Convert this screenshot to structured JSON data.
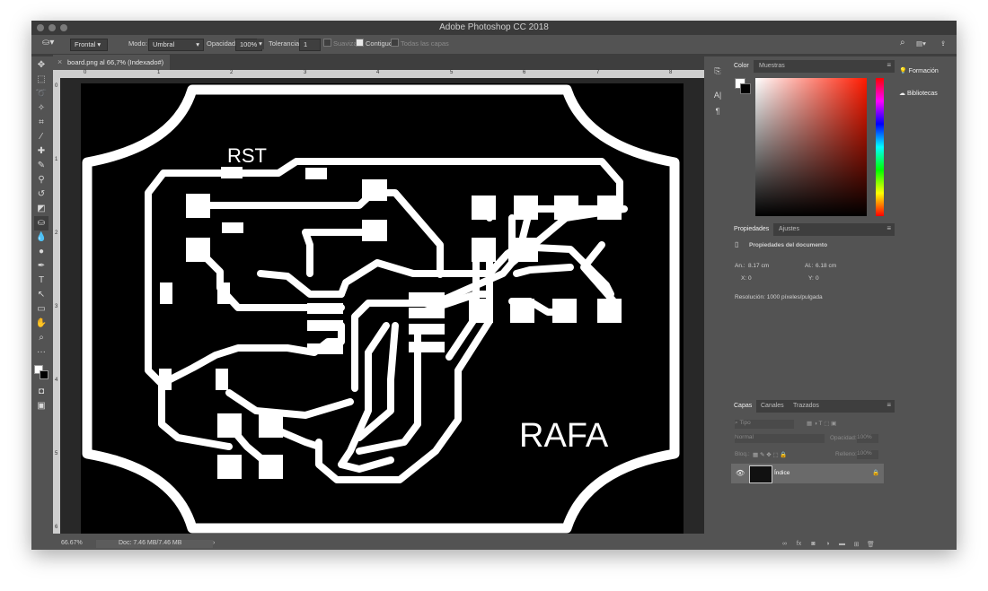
{
  "window": {
    "title": "Adobe Photoshop CC 2018"
  },
  "options_bar": {
    "preset": "Frontal",
    "mode_label": "Modo:",
    "mode_value": "Umbral",
    "opacity_label": "Opacidad:",
    "opacity_value": "100%",
    "tolerance_label": "Tolerancia:",
    "tolerance_value": "1",
    "smooth_label": "Suavizar",
    "contiguous_label": "Contiguo",
    "all_layers_label": "Todas las capas"
  },
  "document": {
    "tab_label": "board.png al 66,7% (Indexado#)",
    "zoom": "66.67%",
    "doc_size": "Doc: 7.46 MB/7.46 MB",
    "ruler_h": [
      "0",
      "1",
      "2",
      "3",
      "4",
      "5",
      "6",
      "7",
      "8"
    ],
    "ruler_v": [
      "0",
      "1",
      "2",
      "3",
      "4",
      "5",
      "6"
    ],
    "board_text_1": "RST",
    "board_text_2": "RAFA"
  },
  "color_panel": {
    "tabs": [
      "Color",
      "Muestras"
    ],
    "hue_base": "#ff1a00"
  },
  "properties_panel": {
    "tabs": [
      "Propiedades",
      "Ajustes"
    ],
    "heading": "Propiedades del documento",
    "width_label": "An.:",
    "width_value": "8.17 cm",
    "height_label": "Al.:",
    "height_value": "6.18 cm",
    "x_label": "X:",
    "x_value": "0",
    "y_label": "Y:",
    "y_value": "0",
    "resolution": "Resolución: 1000 píxeles/pulgada"
  },
  "layers_panel": {
    "tabs": [
      "Capas",
      "Canales",
      "Trazados"
    ],
    "filter_placeholder": "Tipo",
    "blend_mode": "Normal",
    "opacity_label": "Opacidad:",
    "opacity_value": "100%",
    "lock_label": "Bloq.:",
    "fill_label": "Relleno:",
    "fill_value": "100%",
    "layer_name": "Índice"
  },
  "right_column": {
    "learn": "Formación",
    "libraries": "Bibliotecas"
  }
}
